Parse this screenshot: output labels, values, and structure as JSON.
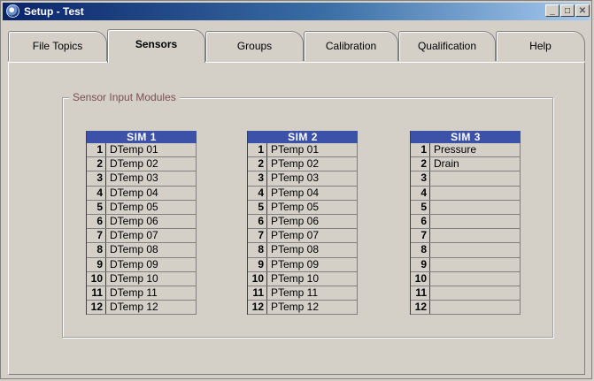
{
  "window": {
    "title": "Setup - Test"
  },
  "tabs": [
    {
      "label": "File Topics",
      "active": false
    },
    {
      "label": "Sensors",
      "active": true
    },
    {
      "label": "Groups",
      "active": false
    },
    {
      "label": "Calibration",
      "active": false
    },
    {
      "label": "Qualification",
      "active": false
    },
    {
      "label": "Help",
      "active": false
    }
  ],
  "group": {
    "label": "Sensor Input Modules"
  },
  "sims": [
    {
      "title": "SIM 1",
      "rows": [
        {
          "num": "1",
          "value": "DTemp 01"
        },
        {
          "num": "2",
          "value": "DTemp 02"
        },
        {
          "num": "3",
          "value": "DTemp 03"
        },
        {
          "num": "4",
          "value": "DTemp 04"
        },
        {
          "num": "5",
          "value": "DTemp 05"
        },
        {
          "num": "6",
          "value": "DTemp 06"
        },
        {
          "num": "7",
          "value": "DTemp 07"
        },
        {
          "num": "8",
          "value": "DTemp 08"
        },
        {
          "num": "9",
          "value": "DTemp 09"
        },
        {
          "num": "10",
          "value": "DTemp 10"
        },
        {
          "num": "11",
          "value": "DTemp 11"
        },
        {
          "num": "12",
          "value": "DTemp 12"
        }
      ]
    },
    {
      "title": "SIM 2",
      "rows": [
        {
          "num": "1",
          "value": "PTemp 01"
        },
        {
          "num": "2",
          "value": "PTemp 02"
        },
        {
          "num": "3",
          "value": "PTemp 03"
        },
        {
          "num": "4",
          "value": "PTemp 04"
        },
        {
          "num": "5",
          "value": "PTemp 05"
        },
        {
          "num": "6",
          "value": "PTemp 06"
        },
        {
          "num": "7",
          "value": "PTemp 07"
        },
        {
          "num": "8",
          "value": "PTemp 08"
        },
        {
          "num": "9",
          "value": "PTemp 09"
        },
        {
          "num": "10",
          "value": "PTemp 10"
        },
        {
          "num": "11",
          "value": "PTemp 11"
        },
        {
          "num": "12",
          "value": "PTemp 12"
        }
      ]
    },
    {
      "title": "SIM 3",
      "rows": [
        {
          "num": "1",
          "value": "Pressure"
        },
        {
          "num": "2",
          "value": "Drain"
        },
        {
          "num": "3",
          "value": ""
        },
        {
          "num": "4",
          "value": ""
        },
        {
          "num": "5",
          "value": ""
        },
        {
          "num": "6",
          "value": ""
        },
        {
          "num": "7",
          "value": ""
        },
        {
          "num": "8",
          "value": ""
        },
        {
          "num": "9",
          "value": ""
        },
        {
          "num": "10",
          "value": ""
        },
        {
          "num": "11",
          "value": ""
        },
        {
          "num": "12",
          "value": ""
        }
      ]
    }
  ],
  "icons": {
    "app": "setup-globe-icon",
    "minimize": "minimize-icon",
    "maximize": "maximize-icon",
    "close": "close-icon"
  }
}
